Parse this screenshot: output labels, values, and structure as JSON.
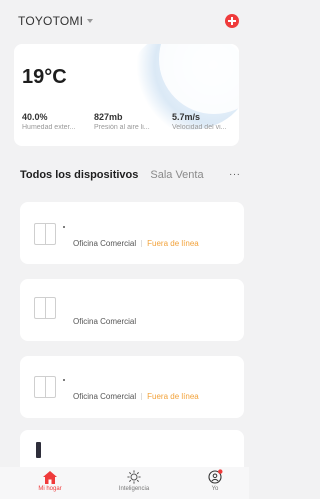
{
  "header": {
    "home_name": "TOYOTOMI",
    "add_icon": "plus-circle-icon",
    "accent_color": "#ef3b3b"
  },
  "weather": {
    "temperature": "19°C",
    "stats": [
      {
        "value": "40.0%",
        "label": "Humedad exter..."
      },
      {
        "value": "827mb",
        "label": "Presión al aire li..."
      },
      {
        "value": "5.7m/s",
        "label": "Velocidad del vi..."
      }
    ]
  },
  "tabs": {
    "active": "Todos los dispositivos",
    "inactive": "Sala Venta",
    "more": "···"
  },
  "devices": [
    {
      "name": "Oficina Comercial",
      "status": "Fuera de línea",
      "icon": "double-switch-icon"
    },
    {
      "name": "Oficina Comercial",
      "status": "",
      "icon": "double-switch-icon"
    },
    {
      "name": "Oficina Comercial",
      "status": "Fuera de línea",
      "icon": "double-switch-icon"
    }
  ],
  "status_color": "#f2a23a",
  "bottom_nav": [
    {
      "label": "Mi hogar",
      "icon": "home-icon",
      "active": true
    },
    {
      "label": "Inteligencia",
      "icon": "sun-icon",
      "active": false
    },
    {
      "label": "Yo",
      "icon": "user-icon",
      "active": false
    }
  ]
}
